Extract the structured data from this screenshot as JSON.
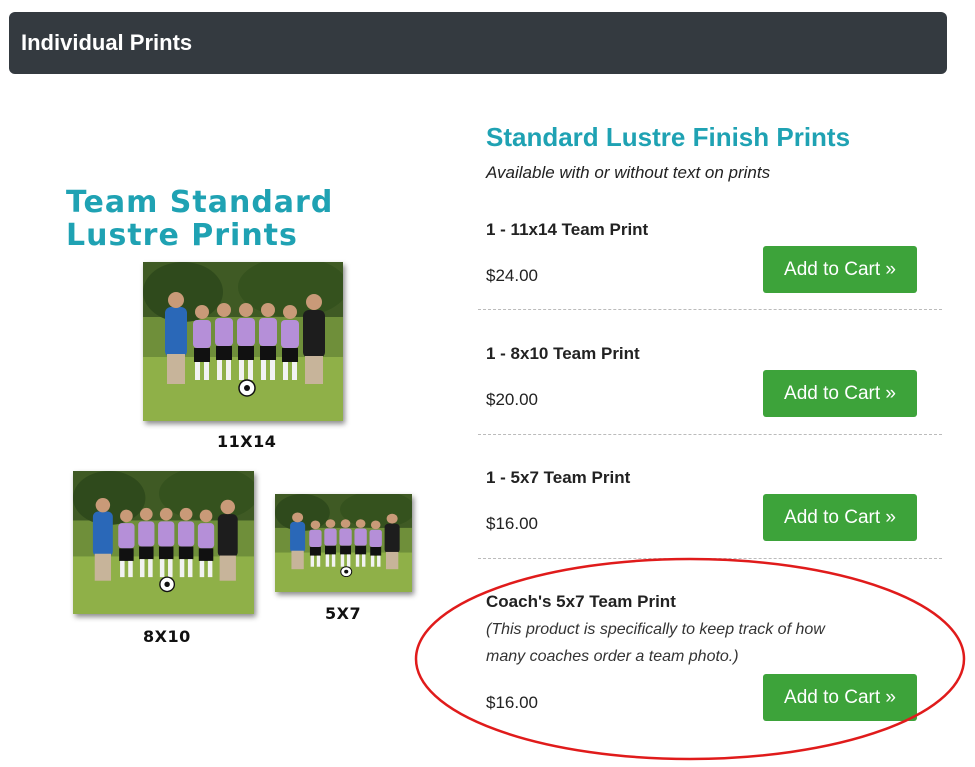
{
  "header": {
    "title": "Individual Prints"
  },
  "left": {
    "heading_line1": "Team Standard",
    "heading_line2": "Lustre Prints",
    "photos": [
      {
        "caption": "11X14"
      },
      {
        "caption": "8X10"
      },
      {
        "caption": "5X7"
      }
    ]
  },
  "right": {
    "heading": "Standard Lustre Finish Prints",
    "subheading": "Available with or without text on prints"
  },
  "products": [
    {
      "name": "1 - 11x14 Team Print",
      "price": "$24.00",
      "button": "Add to Cart »"
    },
    {
      "name": "1 - 8x10 Team Print",
      "price": "$20.00",
      "button": "Add to Cart »"
    },
    {
      "name": "1 - 5x7 Team Print",
      "price": "$16.00",
      "button": "Add to Cart »"
    },
    {
      "name": "Coach's 5x7 Team Print",
      "note_line1": "(This product is specifically to keep track of how",
      "note_line2": "many coaches order a team photo.)",
      "price": "$16.00",
      "button": "Add to Cart »"
    }
  ],
  "colors": {
    "header_bg": "#343a40",
    "accent_teal": "#1fa2b3",
    "button_green": "#3da33a",
    "annotation_red": "#e01b1b"
  }
}
